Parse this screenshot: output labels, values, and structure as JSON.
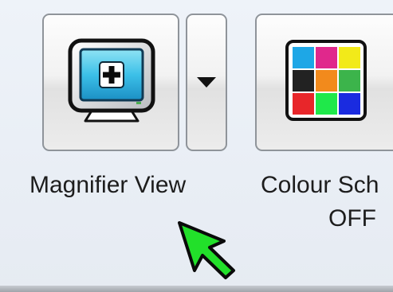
{
  "toolbar": {
    "magnifier": {
      "label": "Magnifier View",
      "icon": "magnifier-monitor-plus-icon",
      "dropdown_icon": "chevron-down-icon"
    },
    "colour_scheme": {
      "label_line1": "Colour Sch",
      "label_line2": "OFF",
      "icon": "colour-grid-icon",
      "swatches": [
        "#1ea7e6",
        "#e0288c",
        "#f2ea19",
        "#222222",
        "#f28a1c",
        "#3cb44b",
        "#e8262a",
        "#1fe84a",
        "#1a2be0"
      ]
    }
  },
  "cursor": {
    "icon": "green-arrow-pointer-icon",
    "color": "#22e02a"
  }
}
